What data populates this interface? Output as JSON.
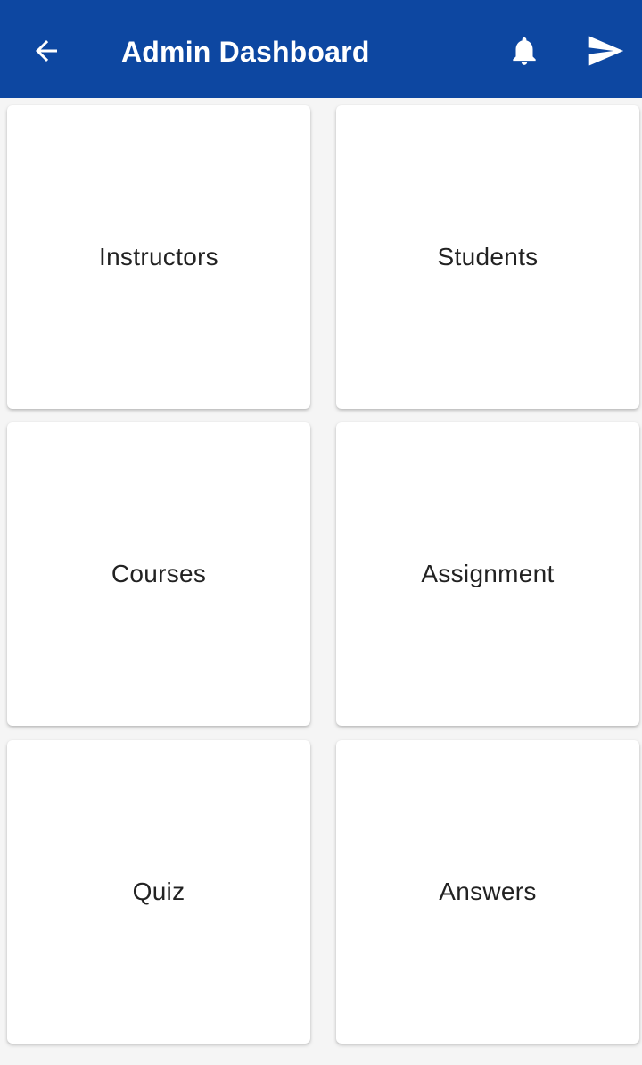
{
  "app_bar": {
    "title": "Admin Dashboard",
    "background": "#0d47a1",
    "icons": {
      "back": "back-arrow-icon",
      "notifications": "bell-icon",
      "send": "send-icon"
    }
  },
  "tiles": [
    {
      "label": "Instructors"
    },
    {
      "label": "Students"
    },
    {
      "label": "Courses"
    },
    {
      "label": "Assignment"
    },
    {
      "label": "Quiz"
    },
    {
      "label": "Answers"
    }
  ]
}
